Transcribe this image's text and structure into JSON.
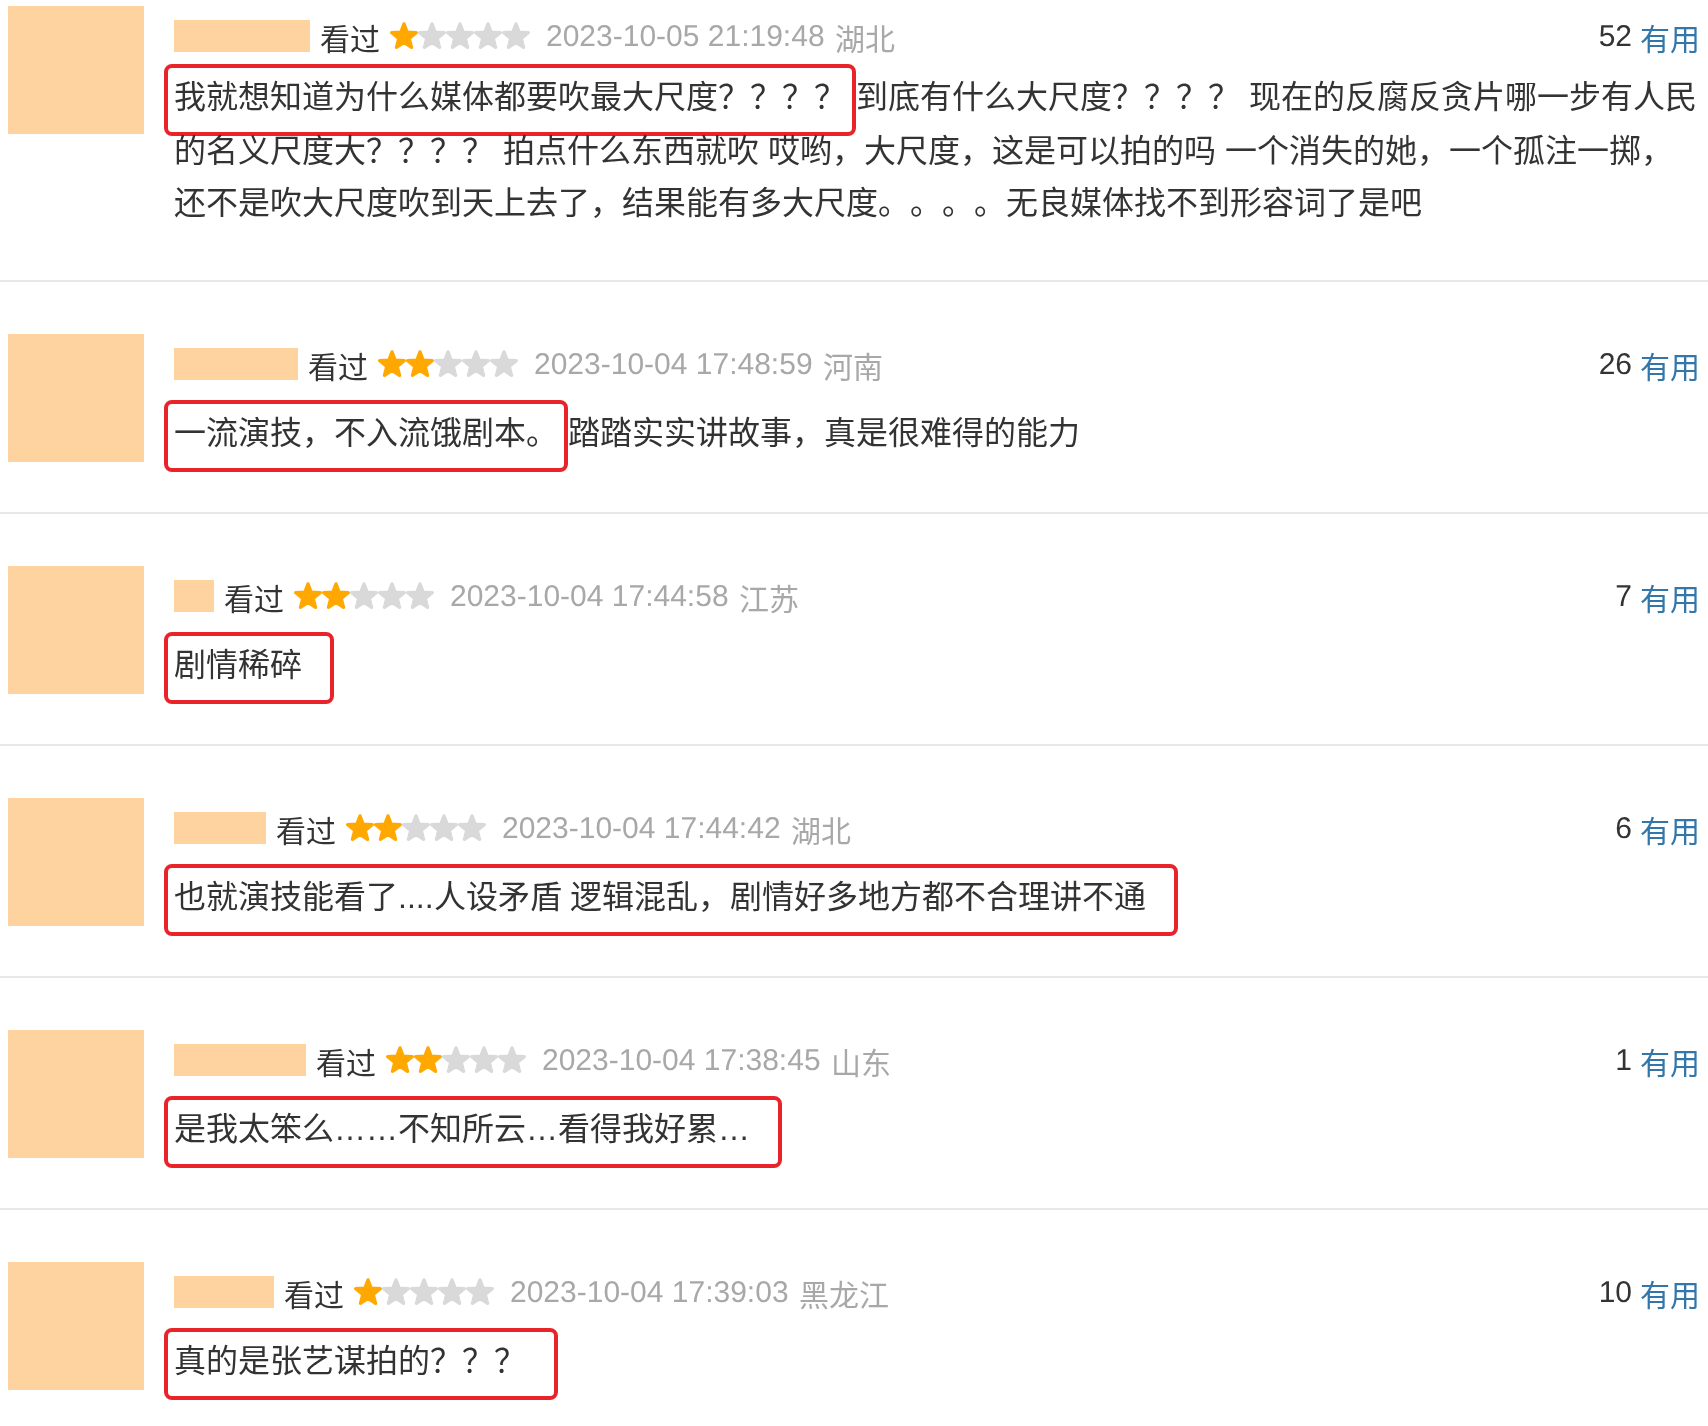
{
  "comments": [
    {
      "status": "看过",
      "stars": 1,
      "time": "2023-10-05 21:19:48",
      "location": "湖北",
      "votes": "52",
      "vote_label": "有用",
      "segments": [
        {
          "text": "我就想知道为什么媒体都要吹最大尺度？？？？",
          "highlighted": true
        },
        {
          "text": "到底有什么大尺度？？？？ 现在的反腐反贪片哪一步有人民的名义尺度大？？？？ 拍点什么东西就吹 哎哟，大尺度，这是可以拍的吗 一个消失的她，一个孤注一掷，还不是吹大尺度吹到天上去了，结果能有多大尺度。。。。无良媒体找不到形容词了是吧",
          "highlighted": false
        }
      ]
    },
    {
      "status": "看过",
      "stars": 2,
      "time": "2023-10-04 17:48:59",
      "location": "河南",
      "votes": "26",
      "vote_label": "有用",
      "segments": [
        {
          "text": "一流演技，不入流饿剧本。",
          "highlighted": true
        },
        {
          "text": "踏踏实实讲故事，真是很难得的能力",
          "highlighted": false
        }
      ]
    },
    {
      "status": "看过",
      "stars": 2,
      "time": "2023-10-04 17:44:58",
      "location": "江苏",
      "votes": "7",
      "vote_label": "有用",
      "segments": [
        {
          "text": "剧情稀碎",
          "highlighted": true
        }
      ]
    },
    {
      "status": "看过",
      "stars": 2,
      "time": "2023-10-04 17:44:42",
      "location": "湖北",
      "votes": "6",
      "vote_label": "有用",
      "segments": [
        {
          "text": "也就演技能看了....人设矛盾 逻辑混乱，剧情好多地方都不合理讲不通",
          "highlighted": true
        }
      ]
    },
    {
      "status": "看过",
      "stars": 2,
      "time": "2023-10-04 17:38:45",
      "location": "山东",
      "votes": "1",
      "vote_label": "有用",
      "segments": [
        {
          "text": "是我太笨么……不知所云…看得我好累…",
          "highlighted": true
        }
      ]
    },
    {
      "status": "看过",
      "stars": 1,
      "time": "2023-10-04 17:39:03",
      "location": "黑龙江",
      "votes": "10",
      "vote_label": "有用",
      "segments": [
        {
          "text": "真的是张艺谋拍的？？？",
          "highlighted": true
        }
      ]
    }
  ]
}
